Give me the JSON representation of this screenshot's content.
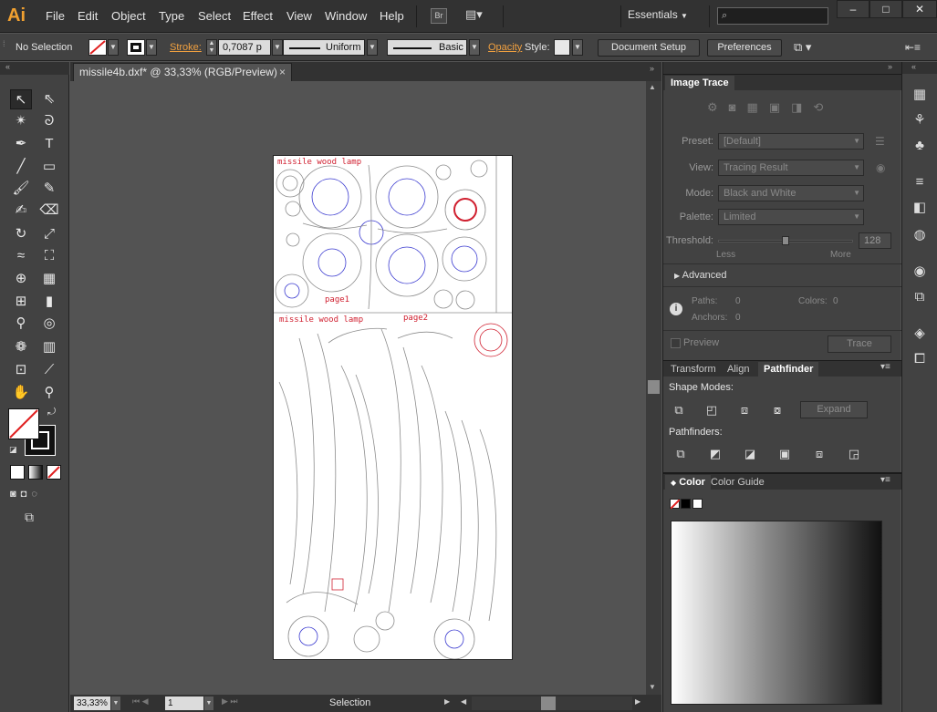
{
  "app": {
    "logo": "Ai",
    "menus": [
      "File",
      "Edit",
      "Object",
      "Type",
      "Select",
      "Effect",
      "View",
      "Window",
      "Help"
    ],
    "bridge_label": "Br",
    "workspace": "Essentials",
    "window_controls": [
      "–",
      "□",
      "✕"
    ]
  },
  "controlbar": {
    "selection": "No Selection",
    "stroke_label": "Stroke:",
    "stroke_weight": "0,7087 p",
    "profile": "Uniform",
    "brush": "Basic",
    "opacity_label": "Opacity",
    "style_label": "Style:",
    "document_setup": "Document Setup",
    "preferences": "Preferences"
  },
  "document": {
    "tab_title": "missile4b.dxf* @ 33,33% (RGB/Preview)",
    "close_glyph": "×",
    "zoom": "33,33%",
    "artboard_number": "1",
    "status_mode": "Selection"
  },
  "artboard_labels": {
    "page1_title": "missile wood lamp",
    "page1_name": "page1",
    "page2_title": "missile wood lamp",
    "page2_name": "page2"
  },
  "image_trace": {
    "title": "Image Trace",
    "preset_label": "Preset:",
    "preset_value": "[Default]",
    "view_label": "View:",
    "view_value": "Tracing Result",
    "mode_label": "Mode:",
    "mode_value": "Black and White",
    "palette_label": "Palette:",
    "palette_value": "Limited",
    "threshold_label": "Threshold:",
    "threshold_value": "128",
    "threshold_fraction": 0.5,
    "less_label": "Less",
    "more_label": "More",
    "advanced_label": "Advanced",
    "paths_label": "Paths:",
    "paths_value": "0",
    "colors_label": "Colors:",
    "colors_value": "0",
    "anchors_label": "Anchors:",
    "anchors_value": "0",
    "preview_label": "Preview",
    "trace_button": "Trace"
  },
  "pathfinder_group": {
    "tabs": [
      "Transform",
      "Align",
      "Pathfinder"
    ],
    "active_tab": "Pathfinder",
    "shape_modes_label": "Shape Modes:",
    "expand_button": "Expand",
    "pathfinders_label": "Pathfinders:"
  },
  "color_group": {
    "tabs": [
      "Color",
      "Color Guide"
    ],
    "active_tab": "Color"
  },
  "colors": {
    "accent": "#f0a030",
    "cut_red": "#d02030",
    "cut_gray": "#8c8c8c",
    "cut_blue": "#3a3ad0"
  }
}
